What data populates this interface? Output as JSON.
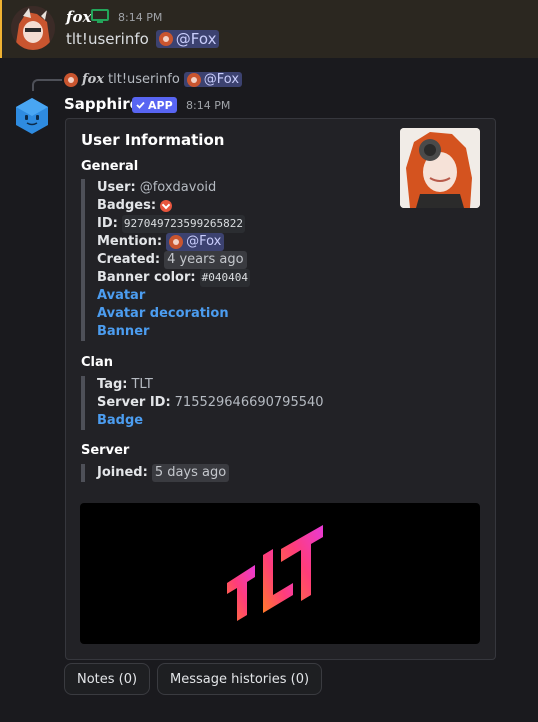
{
  "user_message": {
    "author": "fox",
    "time": "8:14 PM",
    "command": "tlt!userinfo",
    "mention": "@Fox"
  },
  "reply": {
    "author": "fox",
    "command": "tlt!userinfo",
    "mention": "@Fox"
  },
  "bot": {
    "name": "Sapphire",
    "badge": "APP",
    "time": "8:14 PM"
  },
  "embed": {
    "title": "User Information",
    "general": {
      "heading": "General",
      "user_label": "User:",
      "user_value": "@foxdavoid",
      "badges_label": "Badges:",
      "id_label": "ID:",
      "id_value": "927049723599265822",
      "mention_label": "Mention:",
      "mention_value": "@Fox",
      "created_label": "Created:",
      "created_value": "4 years ago",
      "banner_color_label": "Banner color:",
      "banner_color_value": "#040404",
      "avatar_link": "Avatar",
      "decoration_link": "Avatar decoration",
      "banner_link": "Banner"
    },
    "clan": {
      "heading": "Clan",
      "tag_label": "Tag:",
      "tag_value": "TLT",
      "server_id_label": "Server ID:",
      "server_id_value": "715529646690795540",
      "badge_link": "Badge"
    },
    "server": {
      "heading": "Server",
      "joined_label": "Joined:",
      "joined_value": "5 days ago"
    }
  },
  "buttons": {
    "notes": "Notes (0)",
    "histories": "Message histories (0)"
  },
  "colors": {
    "accent": "#5865f2",
    "link": "#4c9df0",
    "highlight_bar": "#f0b232"
  }
}
